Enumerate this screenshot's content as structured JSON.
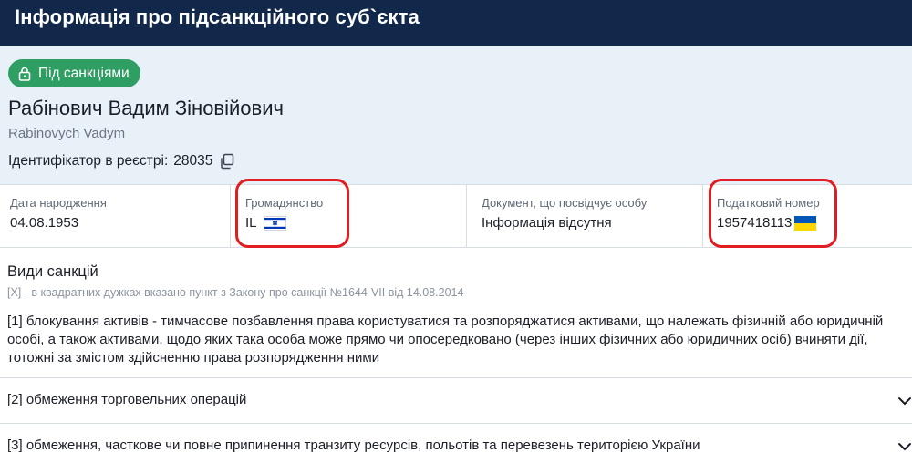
{
  "header": {
    "title": "Інформація про підсанкційного суб`єкта"
  },
  "subject": {
    "status_label": "Під санкціями",
    "name": "Рабінович Вадим Зіновійович",
    "name_latin": "Rabinovych Vadym",
    "registry_id_label": "Ідентифікатор в реєстрі:",
    "registry_id": "28035"
  },
  "info": {
    "birth_label": "Дата народження",
    "birth_value": "04.08.1953",
    "citizenship_label": "Громадянство",
    "citizenship_value": "IL",
    "document_label": "Документ, що посвідчує особу",
    "document_value": "Інформація відсутня",
    "tax_label": "Податковий номер",
    "tax_value": "1957418113"
  },
  "sanctions": {
    "title": "Види санкцій",
    "note": "[X] - в квадратних дужках вказано пункт з Закону про санкції №1644-VII від 14.08.2014",
    "items": [
      {
        "text": "[1] блокування активів - тимчасове позбавлення права користуватися та розпоряджатися активами, що належать фізичній або юридичній особі, а також активами, щодо яких така особа може прямо чи опосередковано (через інших фізичних або юридичних осіб) вчиняти дії, тотожні за змістом здійсненню права розпорядження ними"
      },
      {
        "text": "[2] обмеження торговельних операцій"
      },
      {
        "text": "[3] обмеження, часткове чи повне припинення транзиту ресурсів, польотів та перевезень територією України"
      }
    ]
  },
  "colors": {
    "header_bg": "#12284a",
    "hero_bg": "#e8f1f8",
    "badge_green": "#2e9e62",
    "highlight_red": "#e11d22",
    "flag_ua_blue": "#0057b7",
    "flag_ua_yellow": "#ffd700",
    "flag_il_blue": "#0038b8"
  },
  "icons": {
    "badge": "lock-icon",
    "copy": "copy-icon",
    "citizenship_flag": "israel-flag-icon",
    "tax_flag": "ukraine-flag-icon",
    "expand": "chevron-down-icon"
  }
}
